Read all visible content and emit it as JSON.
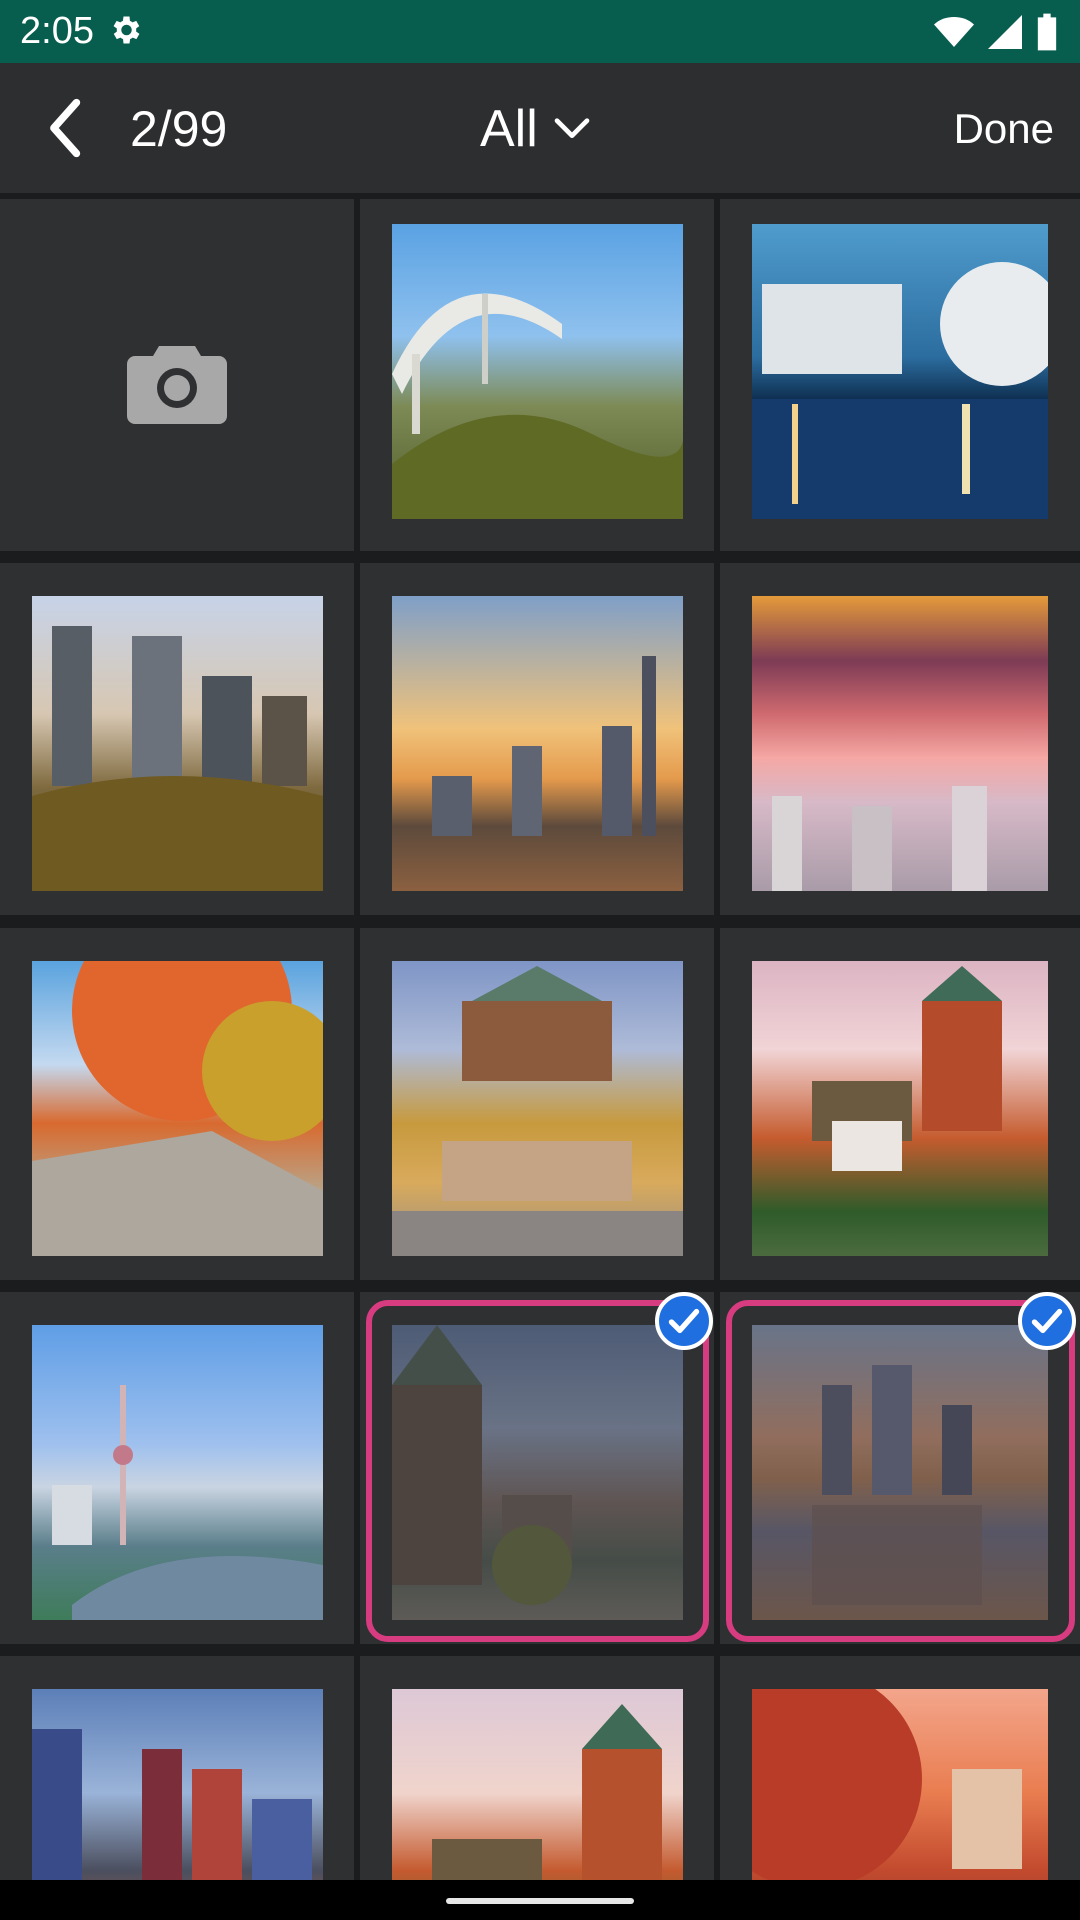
{
  "status_bar": {
    "time": "2:05",
    "icons": [
      "gear-icon",
      "wifi-icon",
      "signal-icon",
      "battery-icon"
    ]
  },
  "header": {
    "back_icon": "chevron-left-icon",
    "counter": "2/99",
    "album_filter": "All",
    "album_filter_icon": "chevron-down-icon",
    "done_label": "Done"
  },
  "grid": {
    "camera_icon": "camera-icon",
    "selected_count": 2,
    "total_count": 99,
    "selected_indices": [
      10,
      11
    ],
    "accent_color": "#d63c7f",
    "check_color": "#1f6fe0"
  }
}
